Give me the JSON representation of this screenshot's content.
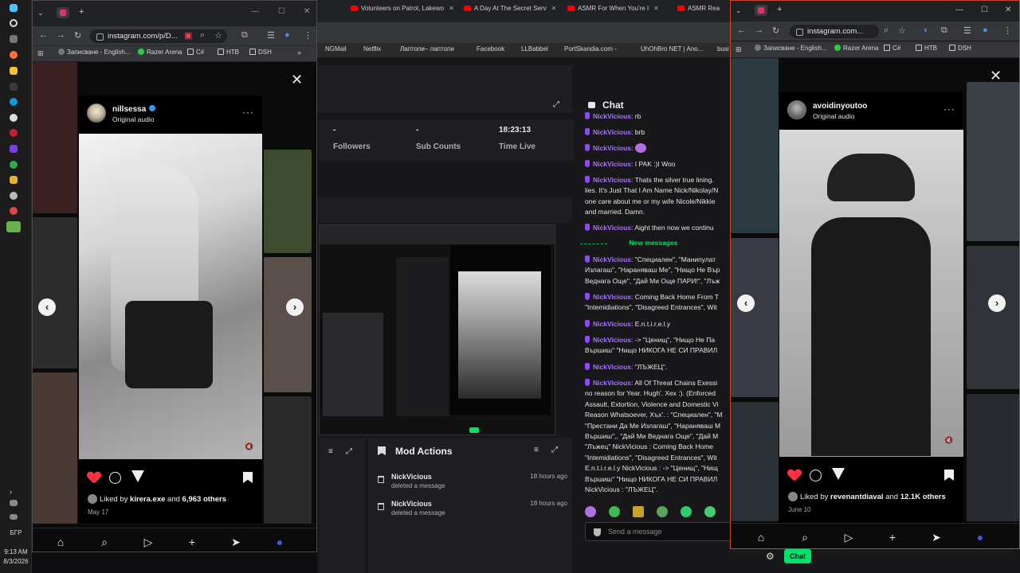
{
  "taskbar": {
    "time": "9:13 AM",
    "date": "8/3/2026",
    "lang": "БГР"
  },
  "back_browser": {
    "tabs": [
      {
        "label": "Volunteers on Patrol, Lakewo"
      },
      {
        "label": "A Day At The Secret Serv"
      },
      {
        "label": "ASMR For When You're I"
      },
      {
        "label": "ASMR Rea"
      }
    ],
    "bookmarks": [
      "NGMail",
      "Netflix",
      "Лаптопи– лаптопи",
      "Facebook",
      "LLBabbel",
      "PortSkandia.com -",
      "UhOhBro NET | Ano...",
      "busi"
    ]
  },
  "dashboard": {
    "stats": [
      {
        "value": "-",
        "label": "Followers"
      },
      {
        "value": "-",
        "label": "Sub Counts"
      },
      {
        "value": "18:23:13",
        "label": "Time Live"
      }
    ],
    "mod_actions": {
      "title": "Mod Actions",
      "items": [
        {
          "user": "NickVicious",
          "action": "deleted a message",
          "time": "18 hours ago"
        },
        {
          "user": "NickVicious",
          "action": "deleted a message",
          "time": "18 hours ago"
        }
      ]
    }
  },
  "chat": {
    "title": "Chat",
    "new_messages_label": "New messages",
    "input_placeholder": "Send a message",
    "messages_before": [
      {
        "user": "NickVicious",
        "text": "rb"
      },
      {
        "user": "NickVicious",
        "text": "brb"
      },
      {
        "user": "NickVicious",
        "text": ""
      },
      {
        "user": "NickVicious",
        "text": "I PAK :)I Woo"
      },
      {
        "user": "NickVicious",
        "text": "Thats the silver true lining.\nlies. It's Just That I Am Name Nick/Nikolay/N\none care about me or my wife Nicole/Nikkie\nand married. Damn."
      },
      {
        "user": "NickVicious",
        "text": "Aight then now we continu"
      }
    ],
    "messages_after": [
      {
        "user": "NickVicious",
        "text": "\"Специален\", \"Манипулат\nИзлагаш\", \"Нараняваш Ме\", \"Нищо Не Вър\nВеднага Още\", \"Дай Ми Още ПАРИ!\", \"Лъж"
      },
      {
        "user": "NickVicious",
        "text": "Coming Back Home From T\n\"Intemidiations\", \"Disagreed Entrances\", Wit"
      },
      {
        "user": "NickVicious",
        "text": "E.n.t.i.r.e.l.y"
      },
      {
        "user": "NickVicious",
        "text": "-> \"Ценищ\", \"Нищо Не Па\nВършиш\" \"Нищо НИКОГА НЕ СИ ПРАВИЛ"
      },
      {
        "user": "NickVicious",
        "text": "\"ЛЪЖЕЦ\"."
      },
      {
        "user": "NickVicious",
        "text": "All Of Threat Chains Exessi\nno reason for Year. Hugh'. Хех :). (Enforced\nAssault, Extortion, Violence and Domestic Vi\nReason Whatsoever, Хъх'. : \"Специален\", \"M\n\"Престани Да Ме Излагаш\", \"Нараняваш М\nВършиш\",, \"Дай Ми Веднага Още\", \"Дай М\n\"Лъжец\" NickVicious : Coming Back Home\n\"Intemidiations\", \"Disagreed Entrances\", Wit\nE.n.t.i.r.e.l.y NickVicious : -> \"Ценищ\", \"Нищ\nВършиш\" \"Нищо НИКОГА НЕ СИ ПРАВИЛ\nNickVicious : \"ЛЪЖЕЦ\"."
      }
    ],
    "bottom_button": "Chat"
  },
  "left_window": {
    "url": "instagram.com/p/D...",
    "bookmarks": [
      "Записване - English...",
      "Razer Arena",
      "C#",
      "НТВ",
      "DSH"
    ],
    "post": {
      "username": "nillsessa",
      "audio": "Original audio",
      "liked_by_user": "kirera.exe",
      "liked_others": "6,963 others",
      "date": "May 17",
      "liked_prefix": "Liked by",
      "and": "and"
    }
  },
  "right_window": {
    "url": "instagram.com...",
    "bookmarks": [
      "Записване - English...",
      "Razer Arena",
      "C#",
      "НТВ",
      "DSH"
    ],
    "post": {
      "username": "avoidinyoutoo",
      "audio": "Original audio",
      "liked_by_user": "revenantdiaval",
      "liked_others": "12.1K others",
      "date": "June 10",
      "liked_prefix": "Liked by",
      "and": "and"
    }
  },
  "colors": {
    "accent_green": "#00e06b",
    "twitch_purple": "#a970ff",
    "like_red": "#ff3040"
  }
}
